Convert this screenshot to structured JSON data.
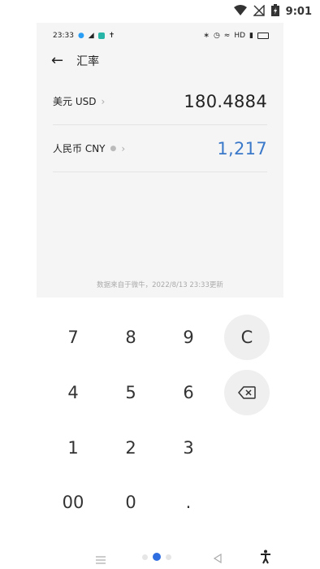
{
  "system_status": {
    "time": "9:01"
  },
  "inner_status": {
    "time": "23:33",
    "right_text": "HD"
  },
  "header": {
    "title": "汇率"
  },
  "rows": [
    {
      "currency": "美元 USD",
      "value": "180.4884",
      "active": false
    },
    {
      "currency": "人民币 CNY",
      "value": "1,217",
      "active": true
    }
  ],
  "footnote": "数据来自于微牛，2022/8/13 23:33更新",
  "keypad": {
    "k7": "7",
    "k8": "8",
    "k9": "9",
    "clear": "C",
    "k4": "4",
    "k5": "5",
    "k6": "6",
    "k1": "1",
    "k2": "2",
    "k3": "3",
    "k00": "00",
    "k0": "0",
    "dot": "."
  },
  "icons": {
    "backspace": "backspace-icon",
    "accessibility": "accessibility-icon",
    "menu": "menu-icon",
    "back": "nav-back-icon"
  },
  "colors": {
    "accent": "#3a78c9"
  }
}
